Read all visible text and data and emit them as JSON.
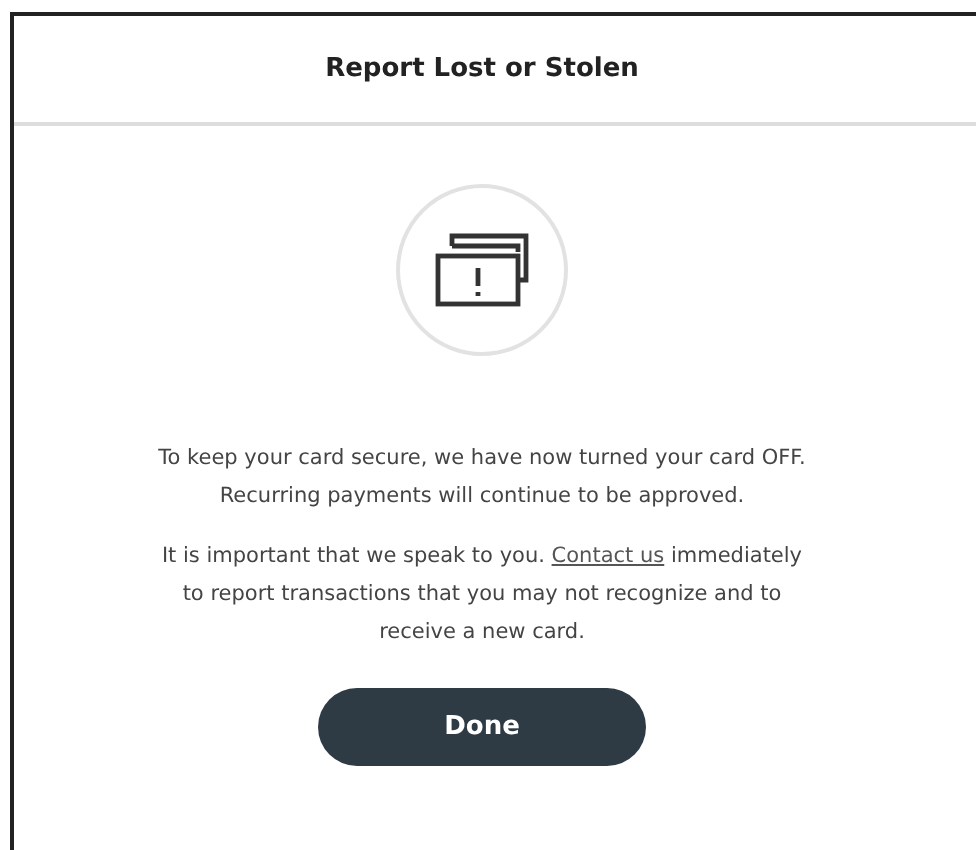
{
  "dialog": {
    "title": "Report Lost or Stolen"
  },
  "paragraphs": [
    {
      "text": "To keep your card secure, we have now turned your card OFF. Recurring payments will continue to be approved."
    },
    {
      "before": "It is important that we speak to you. ",
      "link": "Contact us",
      "after": " immediately to report transactions that you may not recognize and to receive a new card."
    }
  ],
  "button": {
    "label": "Done"
  }
}
